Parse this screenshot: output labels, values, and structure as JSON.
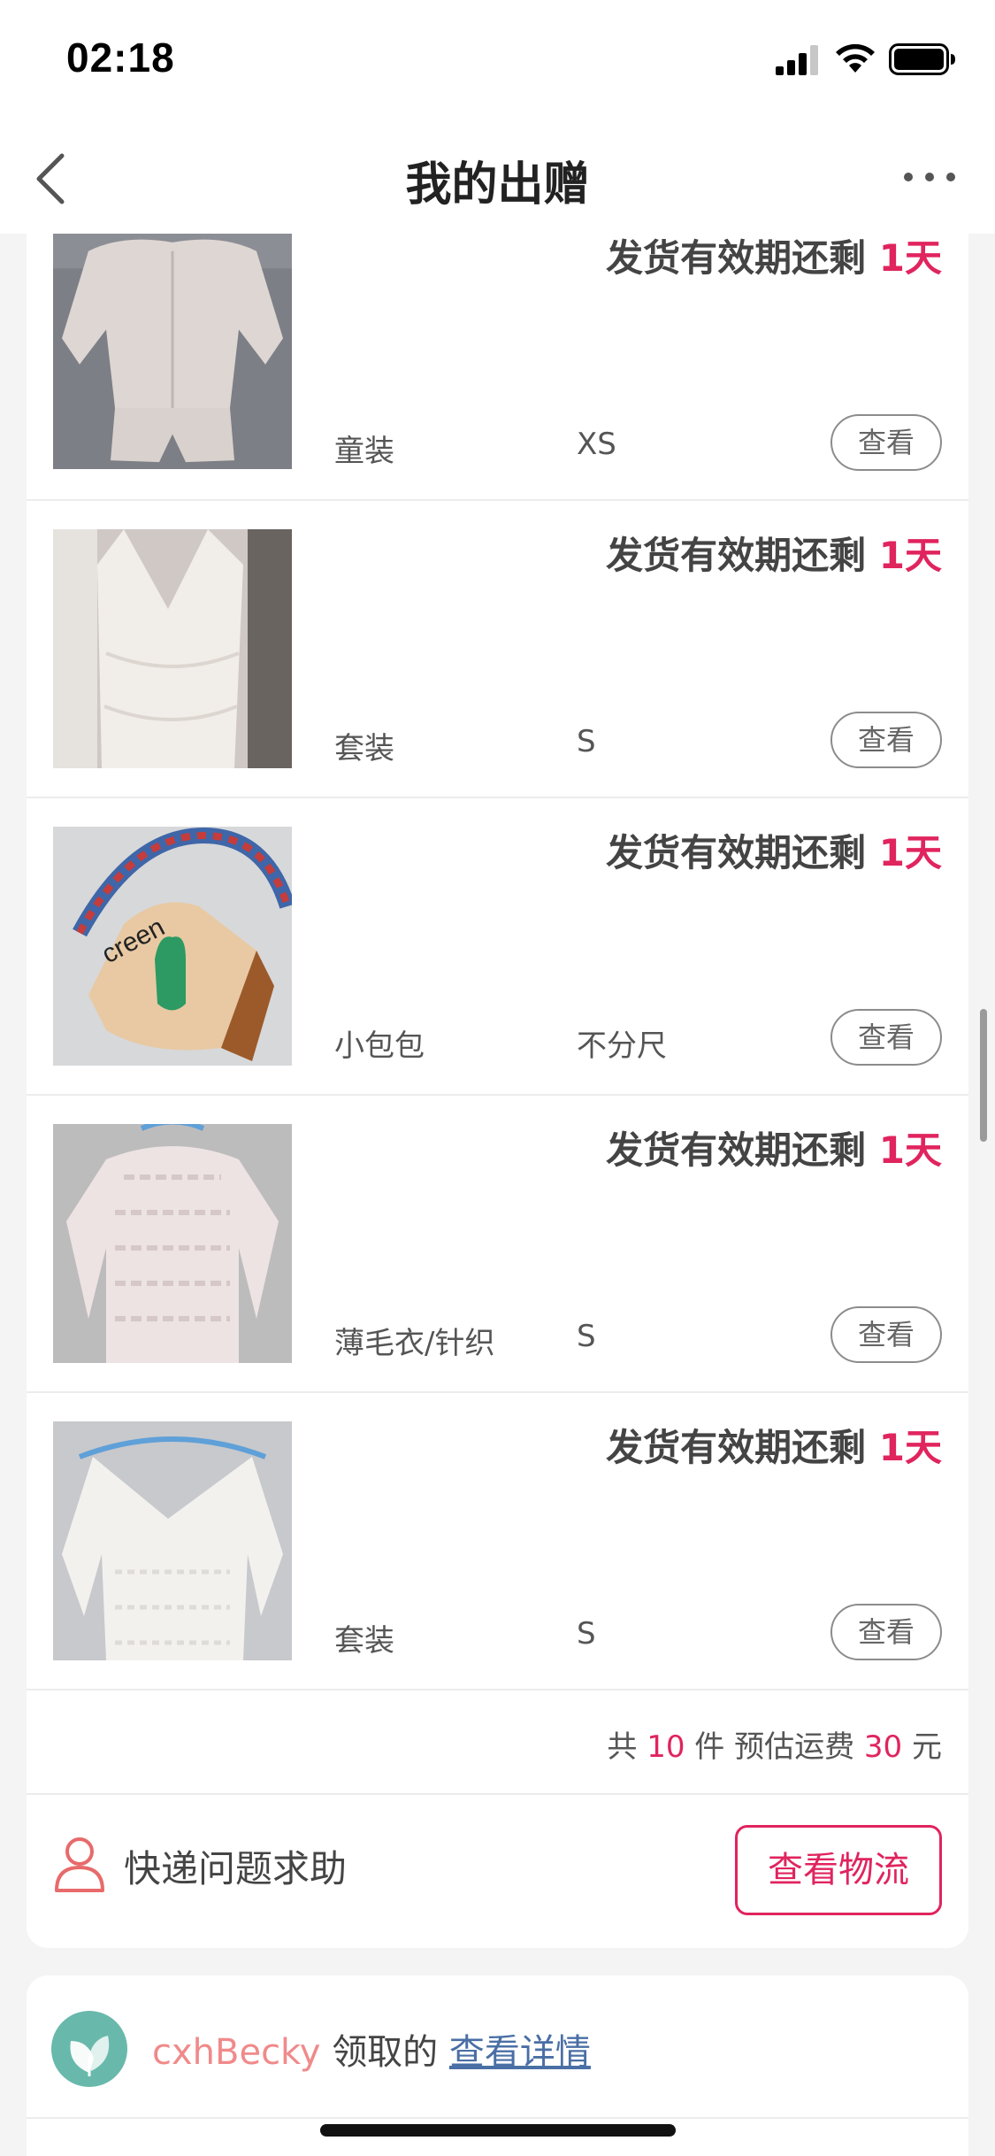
{
  "status_bar": {
    "time": "02:18"
  },
  "nav": {
    "title": "我的出赠"
  },
  "items": [
    {
      "deadline_prefix": "发货有效期还剩",
      "deadline_days": "1天",
      "category": "童装",
      "size": "XS",
      "view_label": "查看",
      "image": "quilted-kids-jacket-shorts"
    },
    {
      "deadline_prefix": "发货有效期还剩",
      "deadline_days": "1天",
      "category": "套装",
      "size": "S",
      "view_label": "查看",
      "image": "white-lace-dress"
    },
    {
      "deadline_prefix": "发货有效期还剩",
      "deadline_days": "1天",
      "category": "小包包",
      "size": "不分尺",
      "view_label": "查看",
      "image": "straw-bag-green-cactus"
    },
    {
      "deadline_prefix": "发货有效期还剩",
      "deadline_days": "1天",
      "category": "薄毛衣/针织",
      "size": "S",
      "view_label": "查看",
      "image": "pink-knit-sweater"
    },
    {
      "deadline_prefix": "发货有效期还剩",
      "deadline_days": "1天",
      "category": "套装",
      "size": "S",
      "view_label": "查看",
      "image": "white-lace-top"
    }
  ],
  "summary": {
    "prefix": "共",
    "count": "10",
    "count_unit": "件",
    "shipping_label": "预估运费",
    "shipping_value": "30",
    "shipping_unit": "元"
  },
  "help": {
    "label": "快递问题求助",
    "logistics_button": "查看物流"
  },
  "receiver": {
    "name": "cxhBecky",
    "action": "领取的",
    "detail_link": "查看详情"
  },
  "colors": {
    "accent": "#e0245e",
    "link": "#4a6fa5",
    "name": "#f08a8a",
    "avatar": "#68b9ab"
  }
}
